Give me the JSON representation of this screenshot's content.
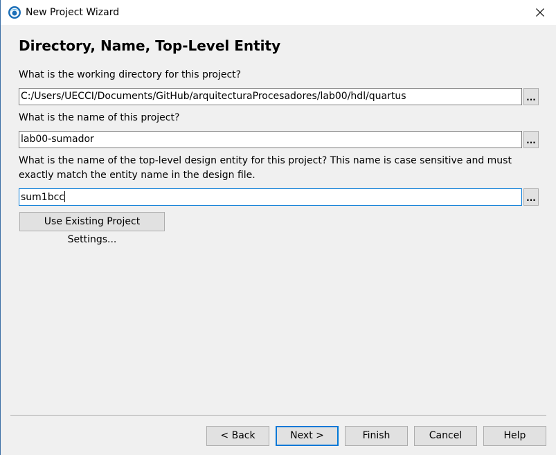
{
  "window": {
    "title": "New Project Wizard",
    "app_icon": "quartus-icon",
    "close_icon": "close-icon"
  },
  "page": {
    "title": "Directory, Name, Top-Level Entity"
  },
  "fields": {
    "directory": {
      "label": "What is the working directory for this project?",
      "value": "C:/Users/UECCI/Documents/GitHub/arquitecturaProcesadores/lab00/hdl/quartus",
      "browse_label": "..."
    },
    "project_name": {
      "label": "What is the name of this project?",
      "value": "lab00-sumador",
      "browse_label": "..."
    },
    "top_level": {
      "label": "What is the name of the top-level design entity for this project? This name is case sensitive and must exactly match the entity name in the design file.",
      "value": "sum1bcc",
      "browse_label": "..."
    }
  },
  "use_existing_label": "Use Existing Project Settings...",
  "buttons": {
    "back": "< Back",
    "next": "Next >",
    "finish": "Finish",
    "cancel": "Cancel",
    "help": "Help"
  }
}
